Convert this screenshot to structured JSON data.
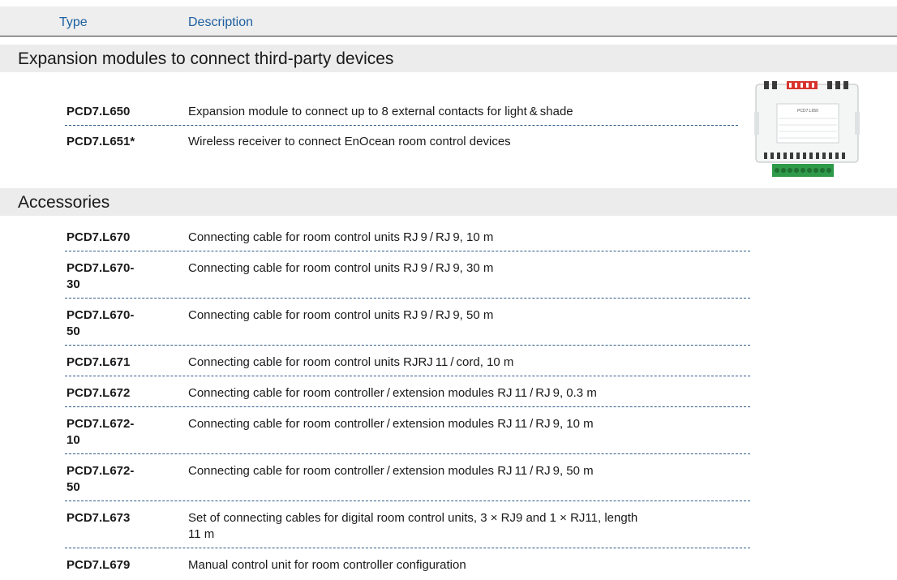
{
  "header": {
    "type_label": "Type",
    "description_label": "Description"
  },
  "section1": {
    "title": "Expansion modules to connect third-party devices",
    "rows": [
      {
        "type": "PCD7.L650",
        "description": "Expansion module to connect up to 8 external contacts for light & shade"
      },
      {
        "type": "PCD7.L651*",
        "description": "Wireless receiver to connect EnOcean room control devices"
      }
    ]
  },
  "section2": {
    "title": "Accessories",
    "rows": [
      {
        "type": "PCD7.L670",
        "description": "Connecting cable for room control units RJ 9 / RJ 9, 10 m"
      },
      {
        "type": "PCD7.L670-30",
        "description": "Connecting cable for room control units RJ 9 / RJ 9, 30 m"
      },
      {
        "type": "PCD7.L670-50",
        "description": "Connecting cable for room control units RJ 9 / RJ 9, 50 m"
      },
      {
        "type": "PCD7.L671",
        "description": "Connecting cable for room control units RJRJ 11 / cord, 10 m"
      },
      {
        "type": "PCD7.L672",
        "description": "Connecting cable for room controller / extension modules RJ 11 / RJ 9, 0.3 m"
      },
      {
        "type": "PCD7.L672-10",
        "description": "Connecting cable for room controller / extension modules RJ 11 / RJ 9, 10 m"
      },
      {
        "type": "PCD7.L672-50",
        "description": "Connecting cable for room controller / extension modules RJ 11 / RJ 9, 50 m"
      },
      {
        "type": "PCD7.L673",
        "description": "Set of connecting cables for digital room control units, 3 × RJ9 and 1 × RJ11, length 11 m"
      },
      {
        "type": "PCD7.L679",
        "description": "Manual control unit for room controller configuration"
      }
    ]
  },
  "product_image": {
    "label": "PCD7.L650"
  }
}
